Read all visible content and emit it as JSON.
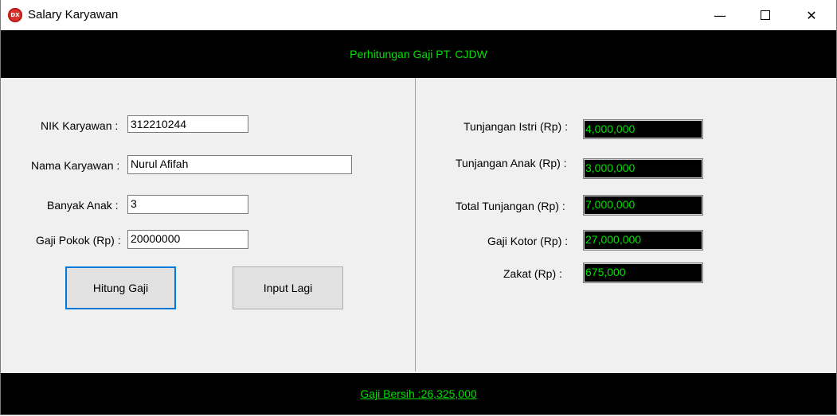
{
  "window": {
    "title": "Salary Karyawan",
    "app_icon_text": "DX",
    "min_glyph": "—",
    "close_glyph": "✕"
  },
  "header": {
    "title": "Perhitungan Gaji PT. CJDW"
  },
  "form": {
    "nik_label": "NIK Karyawan :",
    "nik_value": "312210244",
    "nama_label": "Nama Karyawan :",
    "nama_value": "Nurul Afifah",
    "anak_label": "Banyak Anak :",
    "anak_value": "3",
    "gaji_pokok_label": "Gaji Pokok (Rp) :",
    "gaji_pokok_value": "20000000",
    "hitung_button": "Hitung Gaji",
    "input_lagi_button": "Input Lagi"
  },
  "results": {
    "tunjangan_istri_label": "Tunjangan Istri (Rp) :",
    "tunjangan_istri_value": "4,000,000",
    "tunjangan_anak_label": "Tunjangan Anak (Rp) :",
    "tunjangan_anak_value": "3,000,000",
    "total_tunjangan_label": "Total Tunjangan (Rp) :",
    "total_tunjangan_value": "7,000,000",
    "gaji_kotor_label": "Gaji Kotor (Rp) :",
    "gaji_kotor_value": "27,000,000",
    "zakat_label": "Zakat (Rp) :",
    "zakat_value": "675,000"
  },
  "footer": {
    "gaji_bersih": "Gaji Bersih :26,325,000"
  },
  "colors": {
    "accent_green": "#00e000",
    "bar_background": "#000000",
    "focus_blue": "#0078d7"
  }
}
